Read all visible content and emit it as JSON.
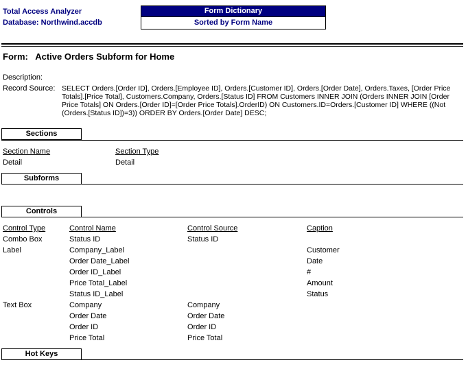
{
  "header": {
    "app_name": "Total Access Analyzer",
    "database": "Database: Northwind.accdb",
    "report_title": "Form Dictionary",
    "report_subtitle": "Sorted by Form Name",
    "colors": {
      "accent": "#000080",
      "text": "#000000"
    }
  },
  "form": {
    "label": "Form:",
    "name": "Active Orders  Subform for Home",
    "description_label": "Description:",
    "description": "",
    "record_source_label": "Record Source:",
    "record_source": "SELECT Orders.[Order ID], Orders.[Employee ID], Orders.[Customer ID], Orders.[Order Date], Orders.Taxes, [Order Price Totals].[Price Total], Customers.Company, Orders.[Status ID] FROM Customers INNER JOIN (Orders INNER JOIN [Order Price Totals] ON Orders.[Order ID]=[Order Price Totals].OrderID) ON Customers.ID=Orders.[Customer ID] WHERE ((Not (Orders.[Status ID])=3)) ORDER BY Orders.[Order Date] DESC;"
  },
  "sections": {
    "title": "Sections",
    "columns": [
      "Section Name",
      "Section Type"
    ],
    "rows": [
      [
        "Detail",
        "Detail"
      ]
    ]
  },
  "subforms": {
    "title": "Subforms"
  },
  "controls": {
    "title": "Controls",
    "columns": [
      "Control Type",
      "Control Name",
      "Control Source",
      "Caption"
    ],
    "rows": [
      [
        "Combo Box",
        "Status ID",
        "Status ID",
        ""
      ],
      [
        "Label",
        "Company_Label",
        "",
        "Customer"
      ],
      [
        "",
        "Order Date_Label",
        "",
        "Date"
      ],
      [
        "",
        "Order ID_Label",
        "",
        "#"
      ],
      [
        "",
        "Price Total_Label",
        "",
        "Amount"
      ],
      [
        "",
        "Status ID_Label",
        "",
        "Status"
      ],
      [
        "Text Box",
        "Company",
        "Company",
        ""
      ],
      [
        "",
        "Order Date",
        "Order Date",
        ""
      ],
      [
        "",
        "Order ID",
        "Order ID",
        ""
      ],
      [
        "",
        "Price Total",
        "Price Total",
        ""
      ]
    ]
  },
  "hot_keys": {
    "title": "Hot Keys"
  }
}
